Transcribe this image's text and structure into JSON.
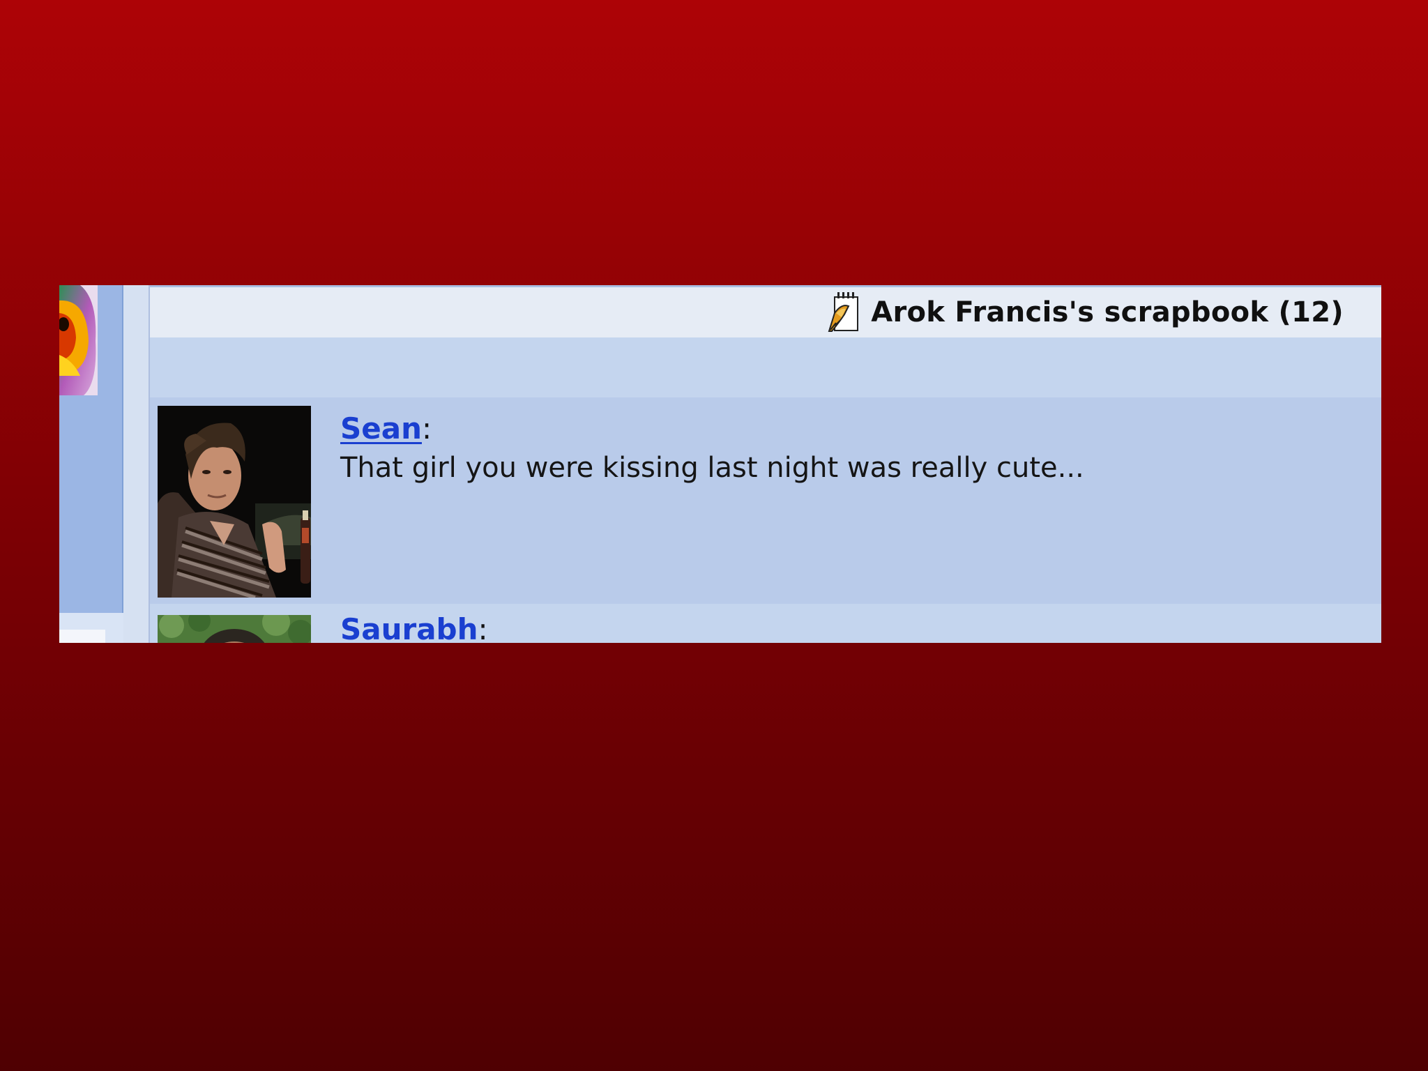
{
  "scrapbook": {
    "title": "Arok Francis's scrapbook (12)",
    "icon": "scrapbook-icon"
  },
  "profile": {
    "logo": "profile-logo"
  },
  "scraps": [
    {
      "author": "Sean",
      "separator": ":",
      "message": "That girl you were kissing last night was really cute...",
      "avatar": "sean-avatar"
    },
    {
      "author": "Saurabh",
      "separator": ":",
      "message": "",
      "avatar": "saurabh-avatar"
    }
  ],
  "colors": {
    "background_top": "#ad0306",
    "background_bottom": "#4f0002",
    "panel": "#c4d5ee",
    "header": "#e6ecf5",
    "link": "#1a3fd0"
  }
}
